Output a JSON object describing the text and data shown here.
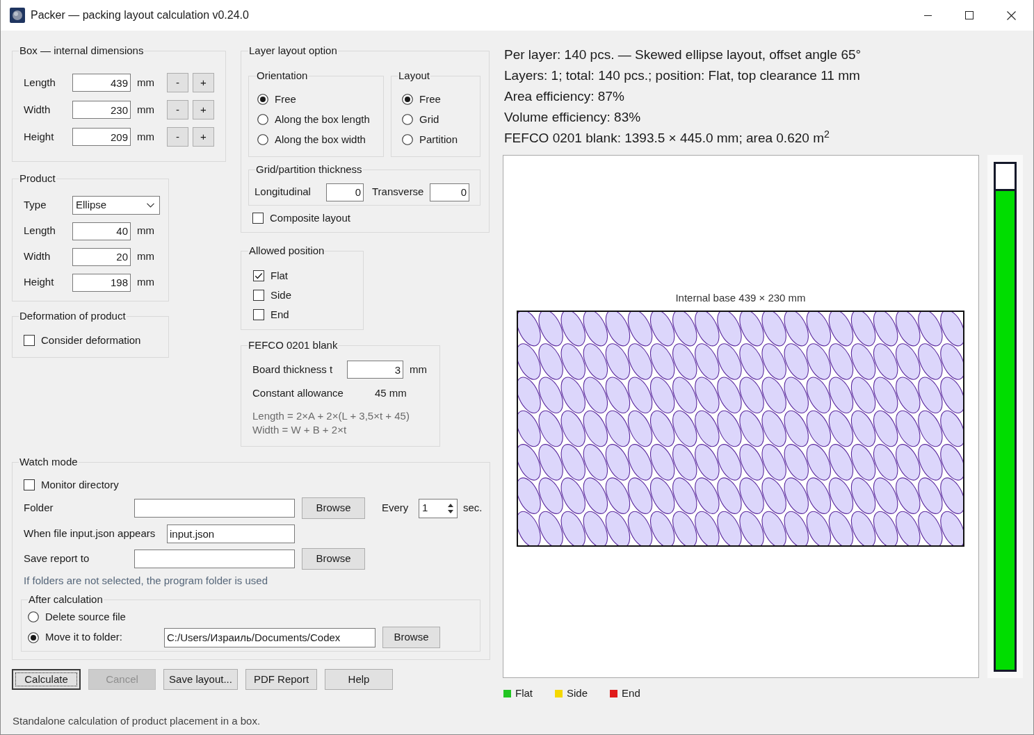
{
  "window": {
    "title": "Packer — packing layout calculation v0.24.0"
  },
  "box": {
    "title": "Box — internal dimensions",
    "rows": [
      {
        "label": "Length",
        "value": "439",
        "unit": "mm",
        "decrement": "-",
        "increment": "+"
      },
      {
        "label": "Width",
        "value": "230",
        "unit": "mm",
        "decrement": "-",
        "increment": "+"
      },
      {
        "label": "Height",
        "value": "209",
        "unit": "mm",
        "decrement": "-",
        "increment": "+"
      }
    ]
  },
  "product": {
    "title": "Product",
    "type": {
      "label": "Type",
      "value": "Ellipse"
    },
    "rows": [
      {
        "label": "Length",
        "value": "40",
        "unit": "mm"
      },
      {
        "label": "Width",
        "value": "20",
        "unit": "mm"
      },
      {
        "label": "Height",
        "value": "198",
        "unit": "mm"
      }
    ]
  },
  "deformation": {
    "title": "Deformation of product",
    "option": {
      "label": "Consider deformation",
      "checked": false
    }
  },
  "layer_layout": {
    "title": "Layer layout option",
    "orientation": {
      "title": "Orientation",
      "options": [
        {
          "label": "Free",
          "selected": true
        },
        {
          "label": "Along the box length",
          "selected": false
        },
        {
          "label": "Along the box width",
          "selected": false
        }
      ]
    },
    "layout": {
      "title": "Layout",
      "options": [
        {
          "label": "Free",
          "selected": true
        },
        {
          "label": "Grid",
          "selected": false
        },
        {
          "label": "Partition",
          "selected": false
        }
      ]
    },
    "thickness": {
      "title": "Grid/partition thickness",
      "fields": [
        {
          "label": "Longitudinal",
          "value": "0"
        },
        {
          "label": "Transverse",
          "value": "0"
        }
      ]
    },
    "composite": {
      "label": "Composite layout",
      "checked": false
    }
  },
  "allowed_position": {
    "title": "Allowed position",
    "options": [
      {
        "label": "Flat",
        "checked": true
      },
      {
        "label": "Side",
        "checked": false
      },
      {
        "label": "End",
        "checked": false
      }
    ]
  },
  "fefco": {
    "title": "FEFCO 0201 blank",
    "board": {
      "label": "Board thickness t",
      "value": "3",
      "unit": "mm"
    },
    "allowance": {
      "label": "Constant allowance",
      "value": "45 mm"
    },
    "formulas": [
      "Length = 2×A + 2×(L + 3,5×t + 45)",
      "Width = W + B + 2×t"
    ]
  },
  "watch_mode": {
    "title": "Watch mode",
    "monitor": {
      "label": "Monitor directory",
      "checked": false
    },
    "folder": {
      "label": "Folder",
      "button": "Browse"
    },
    "interval": {
      "label": "Every",
      "value": "1",
      "unit": "sec."
    },
    "input_file": {
      "label": "When file input.json appears",
      "value": "input.json"
    },
    "report": {
      "label": "Save report to",
      "button": "Browse"
    },
    "hint": "If folders are not selected, the program folder is used",
    "after_calculation": {
      "title": "After calculation",
      "options": [
        {
          "label": "Delete source file",
          "selected": false
        },
        {
          "label": "Move it to folder:",
          "selected": true
        }
      ],
      "folder": {
        "value": "C:/Users/Израиль/Documents/Codex",
        "button": "Browse"
      }
    }
  },
  "buttons": [
    {
      "label": "Calculate",
      "focused": true,
      "disabled": false
    },
    {
      "label": "Cancel",
      "focused": false,
      "disabled": true
    },
    {
      "label": "Save layout...",
      "focused": false,
      "disabled": false
    },
    {
      "label": "PDF Report",
      "focused": false,
      "disabled": false
    },
    {
      "label": "Help",
      "focused": false,
      "disabled": false
    }
  ],
  "status_bar": {
    "text": "Standalone calculation of product placement in a box."
  },
  "results": [
    "Per layer: 140 pcs. — Skewed ellipse layout, offset angle 65°",
    "Layers: 1; total: 140 pcs.; position: Flat, top clearance 11 mm",
    "Area efficiency: 87%",
    "Volume efficiency: 83%",
    "FEFCO 0201 blank: 1393.5 × 445.0 mm; area 0.620 m$^{2}$"
  ],
  "diagram": {
    "title": "Internal base 439 × 230 mm"
  },
  "fill_meter": {
    "level": 0.95
  },
  "legend": [
    {
      "label": "Flat",
      "color": "#22c522"
    },
    {
      "label": "Side",
      "color": "#f5d800"
    },
    {
      "label": "End",
      "color": "#e01b1b"
    }
  ]
}
